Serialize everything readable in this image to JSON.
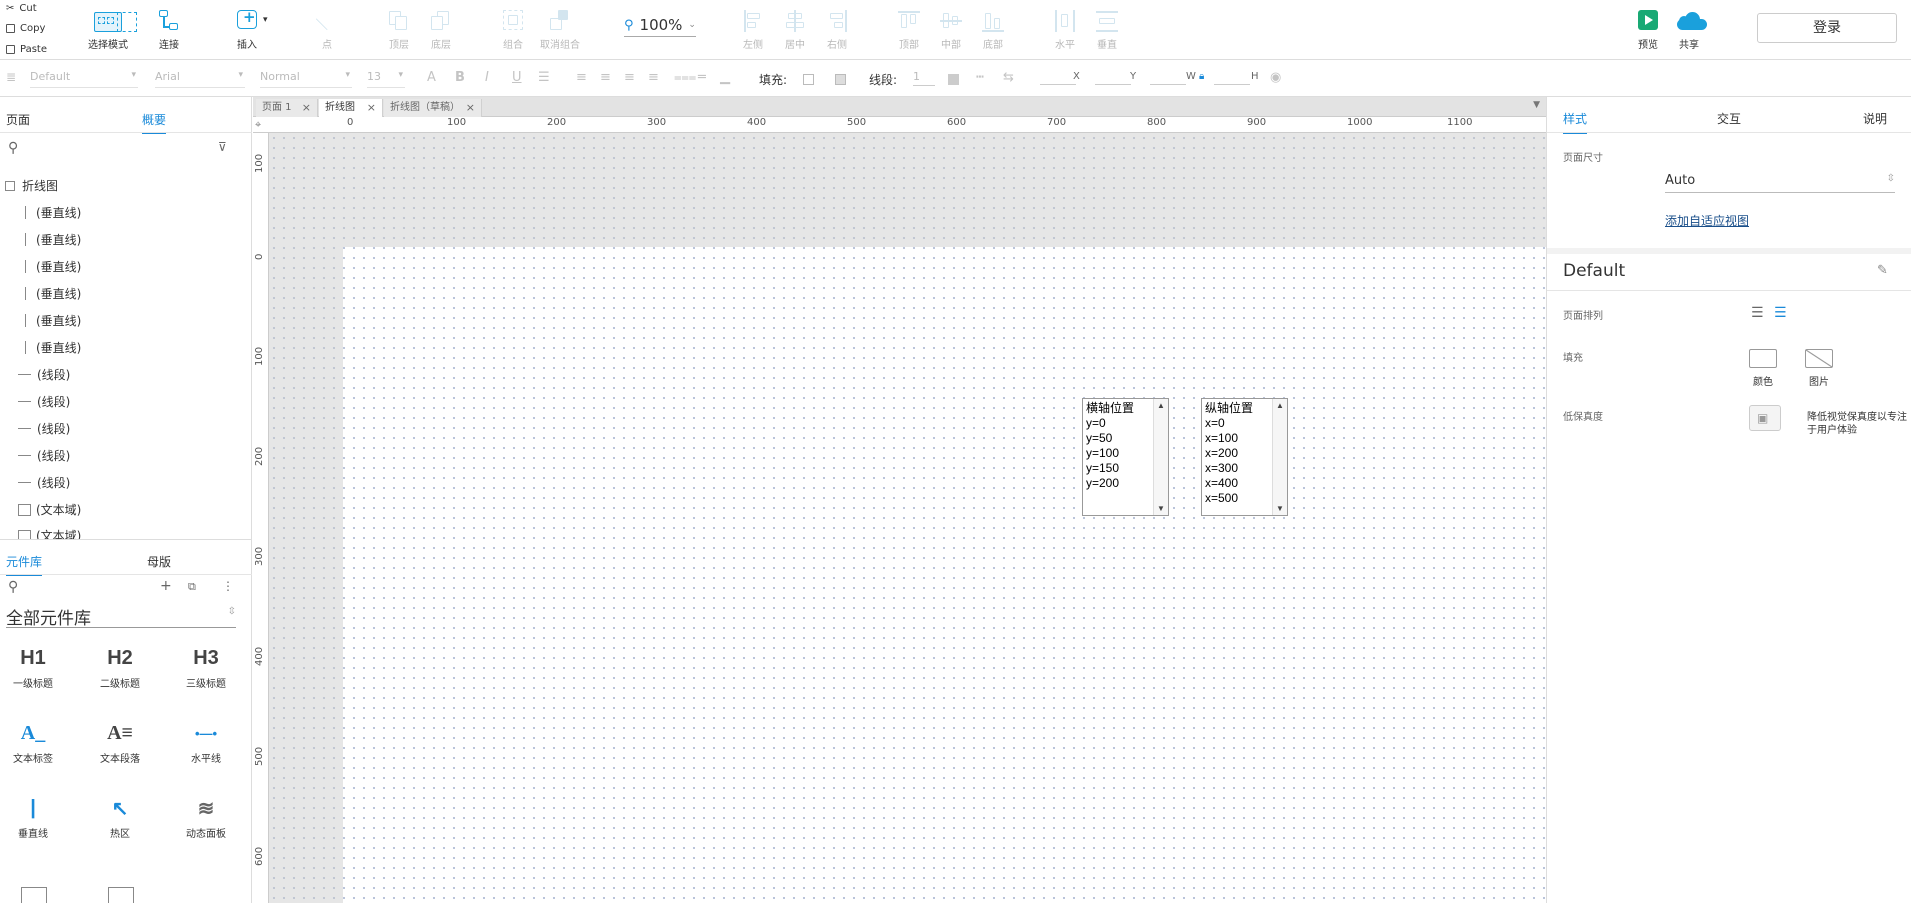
{
  "clipboard": {
    "cut": "Cut",
    "copy": "Copy",
    "paste": "Paste"
  },
  "toolbar": {
    "select_mode": "选择模式",
    "connect": "连接",
    "insert": "插入",
    "point": "点",
    "top": "顶层",
    "bottom": "底层",
    "group": "组合",
    "ungroup": "取消组合",
    "zoom": "100%",
    "align_left": "左侧",
    "align_center": "居中",
    "align_right": "右侧",
    "align_top": "顶部",
    "align_middle": "中部",
    "align_bottom": "底部",
    "distribute_h": "水平",
    "distribute_v": "垂直",
    "preview": "预览",
    "share": "共享",
    "login": "登录"
  },
  "format": {
    "style": "Default",
    "font": "Arial",
    "weight": "Normal",
    "size": "13",
    "fill_label": "填充:",
    "line_label": "线段:",
    "line_value": "1",
    "x_label": "X",
    "y_label": "Y",
    "w_label": "W",
    "h_label": "H"
  },
  "left_panel": {
    "tab_pages": "页面",
    "tab_outline": "概要",
    "tree_root": "折线图",
    "vlines": [
      "(垂直线)",
      "(垂直线)",
      "(垂直线)",
      "(垂直线)",
      "(垂直线)",
      "(垂直线)"
    ],
    "segments": [
      "(线段)",
      "(线段)",
      "(线段)",
      "(线段)",
      "(线段)"
    ],
    "textareas": [
      "(文本域)",
      "(文本域)"
    ],
    "tab_library": "元件库",
    "tab_masters": "母版",
    "library_select": "全部元件库",
    "widgets": [
      {
        "icon": "H1",
        "label": "一级标题"
      },
      {
        "icon": "H2",
        "label": "二级标题"
      },
      {
        "icon": "H3",
        "label": "三级标题"
      },
      {
        "icon": "A_",
        "label": "文本标签"
      },
      {
        "icon": "A≡",
        "label": "文本段落"
      },
      {
        "icon": "•—•",
        "label": "水平线"
      },
      {
        "icon": "|",
        "label": "垂直线"
      },
      {
        "icon": "↖",
        "label": "热区"
      },
      {
        "icon": "≋",
        "label": "动态面板"
      }
    ]
  },
  "doc_tabs": [
    "页面 1",
    "折线图",
    "折线图（草稿）"
  ],
  "rulers": {
    "h": [
      "0",
      "100",
      "200",
      "300",
      "400",
      "500",
      "600",
      "700",
      "800",
      "900",
      "1000",
      "1100"
    ],
    "v": [
      "100",
      "0",
      "100",
      "200",
      "300",
      "400",
      "500",
      "600"
    ]
  },
  "canvas": {
    "listbox_h": {
      "title": "横轴位置",
      "items": [
        "y=0",
        "y=50",
        "y=100",
        "y=150",
        "y=200"
      ]
    },
    "listbox_v": {
      "title": "纵轴位置",
      "items": [
        "x=0",
        "x=100",
        "x=200",
        "x=300",
        "x=400",
        "x=500"
      ]
    }
  },
  "right_panel": {
    "tab_style": "样式",
    "tab_interact": "交互",
    "tab_notes": "说明",
    "page_size_label": "页面尺寸",
    "page_size_value": "Auto",
    "adaptive_link": "添加自适应视图",
    "style_name": "Default",
    "page_align_label": "页面排列",
    "fill_label": "填充",
    "fill_color": "颜色",
    "fill_image": "图片",
    "low_fidelity_label": "低保真度",
    "low_fidelity_desc1": "降低视觉保真度以专注",
    "low_fidelity_desc2": "于用户体验"
  },
  "colors": {
    "accent": "#1a8ad9",
    "icon_blue": "#1aa0dc",
    "preview_green": "#19a974"
  }
}
